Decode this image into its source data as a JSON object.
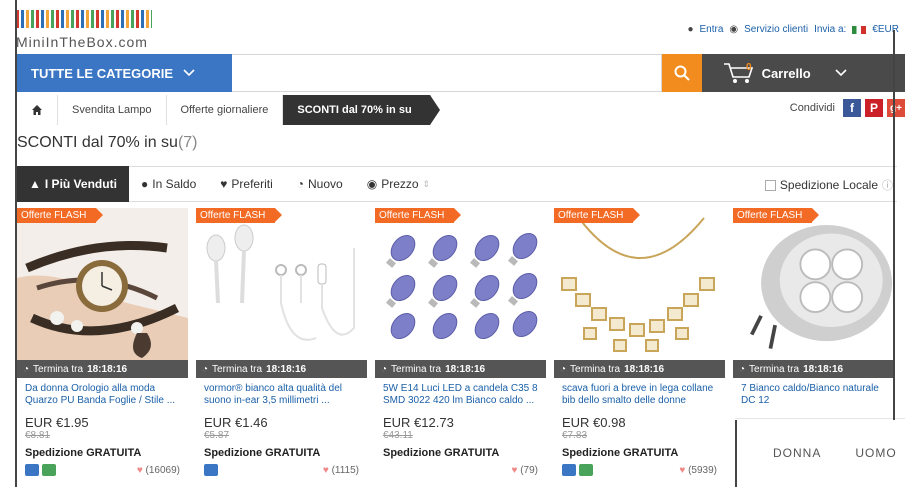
{
  "header": {
    "logo_text": "MiniInTheBox.com",
    "login": "Entra",
    "customer_service": "Servizio clienti",
    "ship_to": "Invia a:",
    "currency": "€EUR"
  },
  "search": {
    "categories_label": "TUTTE LE CATEGORIE",
    "placeholder": "",
    "cart_label": "Carrello",
    "cart_count": "0"
  },
  "breadcrumb": {
    "items": [
      "Svendita Lampo",
      "Offerte giornaliere",
      "SCONTI dal 70% in su"
    ],
    "share_label": "Condividi"
  },
  "page": {
    "title": "SCONTI dal 70% in su",
    "count": "(7)"
  },
  "sort": {
    "items": [
      "I Più Venduti",
      "In Saldo",
      "Preferiti",
      "Nuovo",
      "Prezzo"
    ],
    "local_shipping": "Spedizione Locale"
  },
  "products": [
    {
      "flash": "Offerte FLASH",
      "timer_label": "Termina tra",
      "timer": "18:18:16",
      "name": "Da donna Orologio alla moda Quarzo PU Banda Foglie / Stile ...",
      "price": "EUR €1.95",
      "old_price": "€8.81",
      "shipping": "Spedizione GRATUITA",
      "likes": "(16069)"
    },
    {
      "flash": "Offerte FLASH",
      "timer_label": "Termina tra",
      "timer": "18:18:16",
      "name": "vormor® bianco alta qualità del suono in-ear 3,5 millimetri ...",
      "price": "EUR €1.46",
      "old_price": "€5.87",
      "shipping": "Spedizione GRATUITA",
      "likes": "(1115)"
    },
    {
      "flash": "Offerte FLASH",
      "timer_label": "Termina tra",
      "timer": "18:18:16",
      "name": "5W E14 Luci LED a candela C35 8 SMD 3022 420 lm Bianco caldo ...",
      "price": "EUR €12.73",
      "old_price": "€43.11",
      "shipping": "Spedizione GRATUITA",
      "likes": "(79)"
    },
    {
      "flash": "Offerte FLASH",
      "timer_label": "Termina tra",
      "timer": "18:18:16",
      "name": "scava fuori a breve in lega collane bib dello smalto delle donne",
      "price": "EUR €0.98",
      "old_price": "€7.83",
      "shipping": "Spedizione GRATUITA",
      "likes": "(5939)"
    },
    {
      "flash": "Offerte FLASH",
      "timer_label": "Termina tra",
      "timer": "18:18:16",
      "name": "7 Bianco caldo/Bianco naturale DC 12",
      "price": "",
      "old_price": "",
      "shipping": "",
      "likes": ""
    }
  ],
  "gender_panel": {
    "women": "DONNA",
    "men": "UOMO"
  },
  "colors": {
    "blue": "#3a76c4",
    "orange": "#f28c1e",
    "dark": "#333333",
    "flash": "#f26a24"
  }
}
